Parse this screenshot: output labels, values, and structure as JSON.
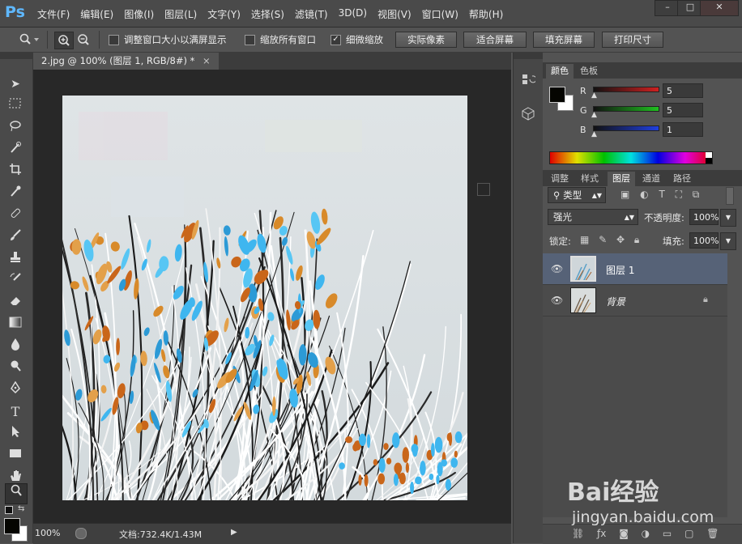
{
  "app": {
    "logo": "Ps"
  },
  "menu": [
    "文件(F)",
    "编辑(E)",
    "图像(I)",
    "图层(L)",
    "文字(Y)",
    "选择(S)",
    "滤镜(T)",
    "3D(D)",
    "视图(V)",
    "窗口(W)",
    "帮助(H)"
  ],
  "window_controls": {
    "minimize": "–",
    "maximize": "□",
    "close": "✕"
  },
  "options": {
    "resize_windows_label": "调整窗口大小以满屏显示",
    "zoom_all_label": "缩放所有窗口",
    "scrubby_label": "细微缩放",
    "scrubby_checked_mark": "✓",
    "actual_pixels": "实际像素",
    "fit_screen": "适合屏幕",
    "fill_screen": "填充屏幕",
    "print_size": "打印尺寸"
  },
  "document": {
    "tab_title": "2.jpg @ 100% (图层 1, RGB/8#) *",
    "tab_close": "×",
    "zoom": "100%",
    "doc_info": "文档:732.4K/1.43M"
  },
  "color_panel": {
    "tabs": [
      "颜色",
      "色板"
    ],
    "channels": [
      {
        "label": "R",
        "value": "5",
        "color": "#d02020"
      },
      {
        "label": "G",
        "value": "5",
        "color": "#20c020"
      },
      {
        "label": "B",
        "value": "1",
        "color": "#2040e0"
      }
    ]
  },
  "layers_panel": {
    "tabs": [
      "调整",
      "样式",
      "图层",
      "通道",
      "路径"
    ],
    "filter_kind": "类型",
    "blend_mode": "强光",
    "opacity_label": "不透明度:",
    "opacity_value": "100%",
    "lock_label": "锁定:",
    "fill_label": "填充:",
    "fill_value": "100%",
    "layers": [
      {
        "name": "图层 1",
        "selected": true
      },
      {
        "name": "背景",
        "selected": false,
        "locked": true
      }
    ]
  },
  "watermark": {
    "brand": "Bai经验",
    "url": "jingyan.baidu.com"
  }
}
